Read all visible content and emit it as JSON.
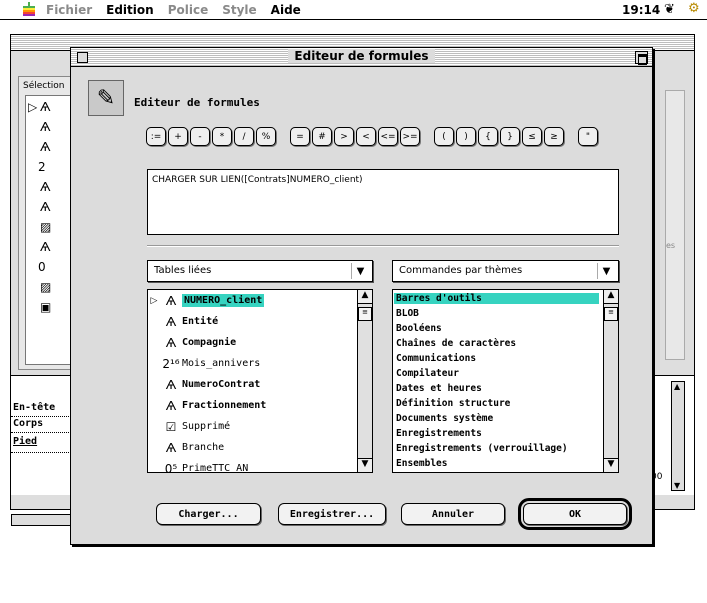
{
  "menubar": {
    "items": [
      {
        "label": "Fichier",
        "enabled": false
      },
      {
        "label": "Edition",
        "enabled": true
      },
      {
        "label": "Police",
        "enabled": false
      },
      {
        "label": "Style",
        "enabled": false
      },
      {
        "label": "Aide",
        "enabled": true
      }
    ],
    "clock": "19:14"
  },
  "background_window": {
    "panel_label": "Sélection",
    "rows": [
      "En-tête",
      "Corps",
      "Pied"
    ],
    "side_text": "es",
    "value": "00"
  },
  "dialog": {
    "title": "Editeur de formules",
    "heading": "Editeur de formules",
    "operators": [
      ":=",
      "+",
      "-",
      "*",
      "/",
      "%",
      "=",
      "#",
      ">",
      "<",
      "<=",
      ">=",
      "(",
      ")",
      "{",
      "}",
      "≤",
      "≥",
      "\""
    ],
    "formula": "CHARGER SUR LIEN([Contrats]NUMERO_client)",
    "fields_dropdown": "Tables liées",
    "commands_dropdown": "Commandes par thèmes",
    "fields": [
      {
        "name": "NUMERO_client",
        "icon": "alpha",
        "bold": true,
        "selected": true
      },
      {
        "name": "Entité",
        "icon": "alpha",
        "bold": true,
        "selected": false
      },
      {
        "name": "Compagnie",
        "icon": "alpha",
        "bold": true,
        "selected": false
      },
      {
        "name": "Mois_annivers",
        "icon": "longint",
        "bold": false,
        "selected": false
      },
      {
        "name": "NumeroContrat",
        "icon": "alpha",
        "bold": true,
        "selected": false
      },
      {
        "name": "Fractionnement",
        "icon": "alpha",
        "bold": true,
        "selected": false
      },
      {
        "name": "Supprimé",
        "icon": "bool",
        "bold": false,
        "selected": false
      },
      {
        "name": "Branche",
        "icon": "alpha",
        "bold": false,
        "selected": false
      },
      {
        "name": "PrimeTTC_AN",
        "icon": "real",
        "bold": false,
        "selected": false
      }
    ],
    "commands": [
      "Barres d'outils",
      "BLOB",
      "Booléens",
      "Chaînes de caractères",
      "Communications",
      "Compilateur",
      "Dates et heures",
      "Définition structure",
      "Documents système",
      "Enregistrements",
      "Enregistrements (verrouillage)",
      "Ensembles"
    ],
    "buttons": {
      "load": "Charger...",
      "save": "Enregistrer...",
      "cancel": "Annuler",
      "ok": "OK"
    }
  },
  "colors": {
    "selection": "#36d3c0",
    "dialog_bg": "#dcdcdc"
  }
}
